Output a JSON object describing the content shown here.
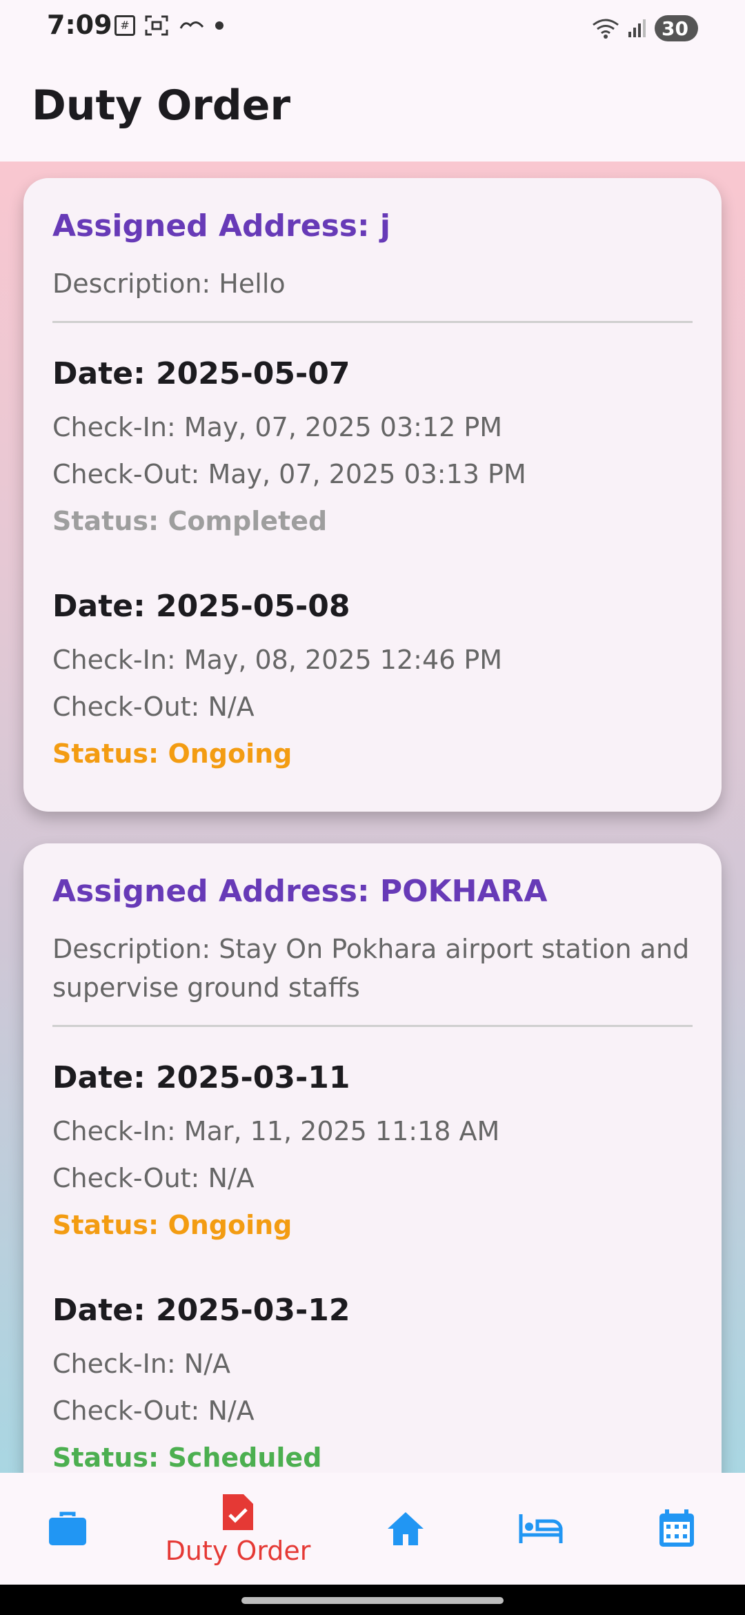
{
  "status_bar": {
    "time": "7:09",
    "battery": "30",
    "left_icons": [
      "sim-icon",
      "screenshot-icon",
      "cloud-icon",
      "dot-icon"
    ],
    "right_icons": [
      "wifi-icon",
      "signal-icon",
      "battery-icon"
    ]
  },
  "app_bar": {
    "title": "Duty Order"
  },
  "cards": [
    {
      "address": "Assigned Address: j",
      "description": "Description: Hello",
      "entries": [
        {
          "date": "Date: 2025-05-07",
          "check_in": "Check-In: May, 07, 2025 03:12 PM",
          "check_out": "Check-Out: May, 07, 2025 03:13 PM",
          "status": "Status: Completed"
        },
        {
          "date": "Date: 2025-05-08",
          "check_in": "Check-In: May, 08, 2025 12:46 PM",
          "check_out": "Check-Out: N/A",
          "status": "Status: Ongoing"
        }
      ]
    },
    {
      "address": "Assigned Address: POKHARA",
      "description": "Description: Stay On Pokhara airport station and supervise ground staffs",
      "entries": [
        {
          "date": "Date: 2025-03-11",
          "check_in": "Check-In: Mar, 11, 2025 11:18 AM",
          "check_out": "Check-Out: N/A",
          "status": "Status: Ongoing"
        },
        {
          "date": "Date: 2025-03-12",
          "check_in": "Check-In: N/A",
          "check_out": "Check-Out: N/A",
          "status": "Status: Scheduled"
        }
      ]
    }
  ],
  "bottom_nav": {
    "items": [
      {
        "icon": "briefcase-icon",
        "label": ""
      },
      {
        "icon": "duty-order-icon",
        "label": "Duty Order",
        "active": true
      },
      {
        "icon": "home-icon",
        "label": ""
      },
      {
        "icon": "bed-icon",
        "label": ""
      },
      {
        "icon": "calendar-icon",
        "label": ""
      }
    ]
  },
  "colors": {
    "address": "#673ab7",
    "completed": "#9e9e9e",
    "ongoing": "#f39c12",
    "scheduled": "#4caf50",
    "nav_icon": "#2196f3",
    "nav_active": "#e53935"
  }
}
